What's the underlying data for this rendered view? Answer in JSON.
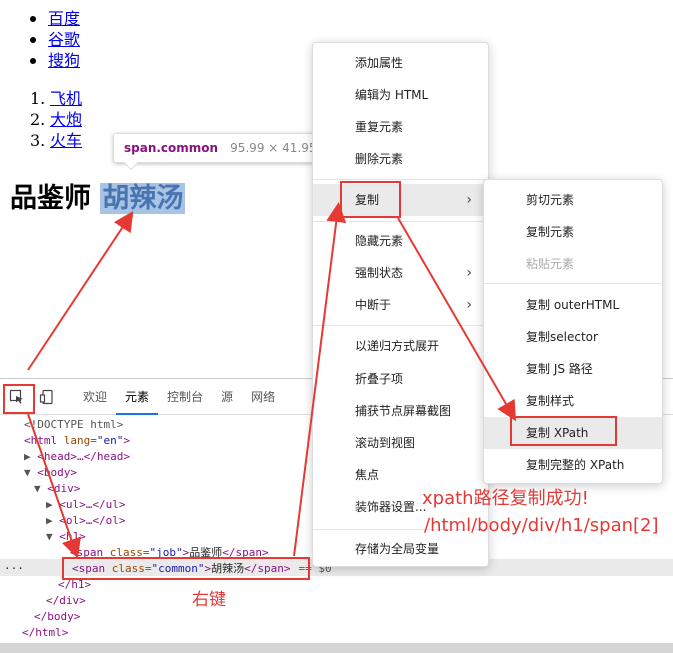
{
  "page": {
    "ul_items": [
      "百度",
      "谷歌",
      "搜狗"
    ],
    "ol_items": [
      {
        "num": "1.",
        "label": "飞机"
      },
      {
        "num": "2.",
        "label": "大炮"
      },
      {
        "num": "3.",
        "label": "火车"
      }
    ],
    "h1_text": "品鉴师",
    "h1_highlight": "胡辣汤"
  },
  "tooltip": {
    "tag": "span.common",
    "size": "95.99 × 41.95"
  },
  "devtools": {
    "tabs": [
      "欢迎",
      "元素",
      "控制台",
      "源",
      "网络"
    ],
    "active_tab": "元素",
    "lines": {
      "doctype": "<!DOCTYPE html>",
      "html_open": "<html",
      "html_attr": " lang=",
      "html_val": "\"en\"",
      "head": "<head>…</head>",
      "body_open": "<body>",
      "div_open": "<div>",
      "ul_line": "<ul>…</ul>",
      "ol_line": "<ol>…</ol>",
      "h1_open": "<h1>",
      "span1_tag": "<span",
      "span1_attr": " class=",
      "span1_val": "\"job\"",
      "span1_text": "品鉴师",
      "span1_close": "</span>",
      "span2_tag": "<span",
      "span2_attr": " class=",
      "span2_val": "\"common\"",
      "span2_text": "胡辣汤",
      "span2_close": "</span>",
      "span2_suffix": "== $0",
      "h1_close": "</h1>",
      "div_close": "</div>",
      "body_close": "</body>",
      "html_close": "</html>",
      "ellipsis": "···"
    }
  },
  "context_menu": {
    "items": [
      {
        "label": "添加属性"
      },
      {
        "label": "编辑为 HTML"
      },
      {
        "label": "重复元素"
      },
      {
        "label": "删除元素"
      },
      {
        "label": "复制",
        "arrow": "›"
      },
      {
        "label": "隐藏元素"
      },
      {
        "label": "强制状态",
        "arrow": "›"
      },
      {
        "label": "中断于",
        "arrow": "›"
      },
      {
        "label": "以递归方式展开"
      },
      {
        "label": "折叠子项"
      },
      {
        "label": "捕获节点屏幕截图"
      },
      {
        "label": "滚动到视图"
      },
      {
        "label": "焦点"
      },
      {
        "label": "装饰器设置..."
      },
      {
        "label": "存储为全局变量"
      }
    ]
  },
  "copy_submenu": {
    "items": [
      {
        "label": "剪切元素"
      },
      {
        "label": "复制元素"
      },
      {
        "label": "粘贴元素"
      },
      {
        "label": "复制 outerHTML"
      },
      {
        "label": "复制selector"
      },
      {
        "label": "复制 JS 路径"
      },
      {
        "label": "复制样式"
      },
      {
        "label": "复制 XPath"
      },
      {
        "label": "复制完整的 XPath"
      }
    ]
  },
  "annotations": {
    "right_click": "右键",
    "success": "xpath路径复制成功!",
    "xpath": "/html/body/div/h1/span[2]"
  },
  "colors": {
    "annotation_red": "#e53935",
    "selection_blue": "#a8c4e4",
    "link": "#0000ee"
  },
  "icons": [
    "inspect-element-icon",
    "device-toolbar-icon",
    "submenu-arrow-icon"
  ]
}
